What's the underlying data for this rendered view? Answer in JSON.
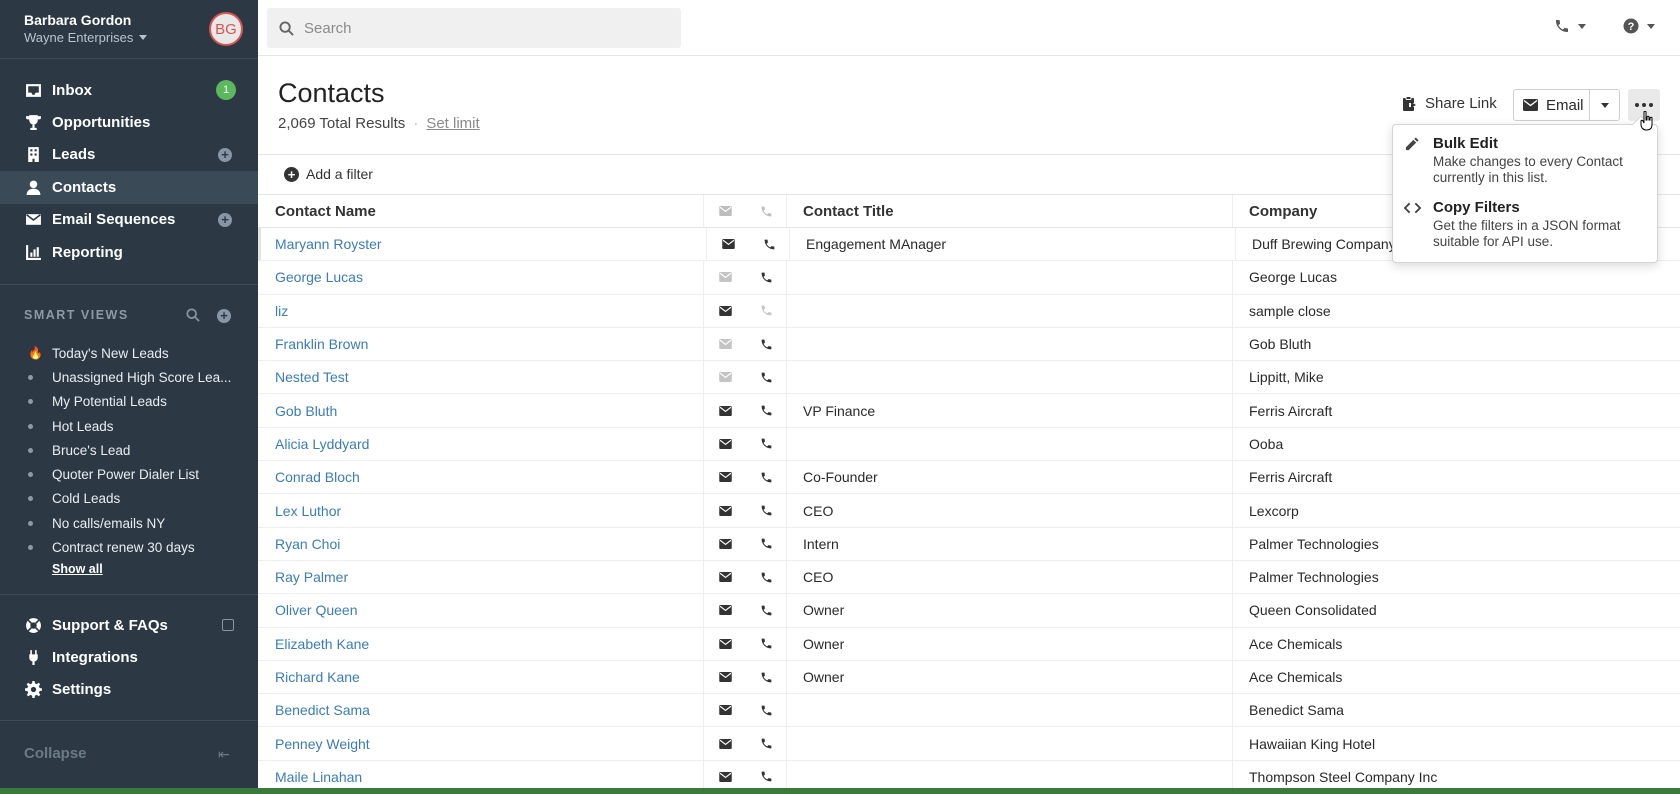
{
  "user": {
    "name": "Barbara Gordon",
    "org": "Wayne Enterprises",
    "initials": "BG"
  },
  "nav": [
    {
      "label": "Inbox",
      "icon": "inbox-icon",
      "badge": "1"
    },
    {
      "label": "Opportunities",
      "icon": "trophy-icon"
    },
    {
      "label": "Leads",
      "icon": "building-icon",
      "add": true
    },
    {
      "label": "Contacts",
      "icon": "person-icon",
      "active": true
    },
    {
      "label": "Email Sequences",
      "icon": "envelope-icon",
      "add": true
    },
    {
      "label": "Reporting",
      "icon": "chart-icon"
    }
  ],
  "smart_views": {
    "header": "SMART VIEWS",
    "items": [
      "Today's New Leads",
      "Unassigned High Score Lea...",
      "My Potential Leads",
      "Hot Leads",
      "Bruce's Lead",
      "Quoter Power Dialer List",
      "Cold Leads",
      "No calls/emails NY",
      "Contract renew 30 days"
    ],
    "show_all": "Show all"
  },
  "nav_bottom": [
    {
      "label": "Support & FAQs",
      "icon": "lifebuoy-icon"
    },
    {
      "label": "Integrations",
      "icon": "plug-icon"
    },
    {
      "label": "Settings",
      "icon": "gear-icon"
    }
  ],
  "collapse_label": "Collapse",
  "search": {
    "placeholder": "Search"
  },
  "page": {
    "title": "Contacts",
    "results": "2,069 Total Results",
    "set_limit": "Set limit",
    "share_link": "Share Link",
    "email_label": "Email",
    "add_filter": "Add a filter"
  },
  "table": {
    "headers": {
      "name": "Contact Name",
      "title": "Contact Title",
      "company": "Company"
    },
    "rows": [
      {
        "name": "Maryann Royster",
        "title": "Engagement MAnager",
        "company": "Duff Brewing Company",
        "email": true,
        "phone": true
      },
      {
        "name": "George Lucas",
        "title": "",
        "company": "George Lucas",
        "email": false,
        "phone": true
      },
      {
        "name": "liz",
        "title": "",
        "company": "sample close",
        "email": true,
        "phone": false
      },
      {
        "name": "Franklin Brown",
        "title": "",
        "company": "Gob Bluth",
        "email": false,
        "phone": true
      },
      {
        "name": "Nested Test",
        "title": "",
        "company": "Lippitt, Mike",
        "email": false,
        "phone": true
      },
      {
        "name": "Gob Bluth",
        "title": "VP Finance",
        "company": "Ferris Aircraft",
        "email": true,
        "phone": true
      },
      {
        "name": "Alicia Lyddyard",
        "title": "",
        "company": "Ooba",
        "email": true,
        "phone": true
      },
      {
        "name": "Conrad Bloch",
        "title": "Co-Founder",
        "company": "Ferris Aircraft",
        "email": true,
        "phone": true
      },
      {
        "name": "Lex Luthor",
        "title": "CEO",
        "company": "Lexcorp",
        "email": true,
        "phone": true
      },
      {
        "name": "Ryan Choi",
        "title": "Intern",
        "company": "Palmer Technologies",
        "email": true,
        "phone": true
      },
      {
        "name": "Ray Palmer",
        "title": "CEO",
        "company": "Palmer Technologies",
        "email": true,
        "phone": true
      },
      {
        "name": "Oliver Queen",
        "title": "Owner",
        "company": "Queen Consolidated",
        "email": true,
        "phone": true
      },
      {
        "name": "Elizabeth Kane",
        "title": "Owner",
        "company": "Ace Chemicals",
        "email": true,
        "phone": true
      },
      {
        "name": "Richard Kane",
        "title": "Owner",
        "company": "Ace Chemicals",
        "email": true,
        "phone": true
      },
      {
        "name": "Benedict Sama",
        "title": "",
        "company": "Benedict Sama",
        "email": true,
        "phone": true
      },
      {
        "name": "Penney Weight",
        "title": "",
        "company": "Hawaiian King Hotel",
        "email": true,
        "phone": true
      },
      {
        "name": "Maile Linahan",
        "title": "",
        "company": "Thompson Steel Company Inc",
        "email": true,
        "phone": true
      }
    ]
  },
  "menu": {
    "bulk_edit": {
      "title": "Bulk Edit",
      "desc": "Make changes to every Contact currently in this list."
    },
    "copy_filters": {
      "title": "Copy Filters",
      "desc": "Get the filters in a JSON format suitable for API use."
    }
  },
  "colors": {
    "sidebar": "#2c3945",
    "link": "#3b7cb8",
    "badge": "#5cb85c",
    "avatar_ring": "#d9534f"
  }
}
